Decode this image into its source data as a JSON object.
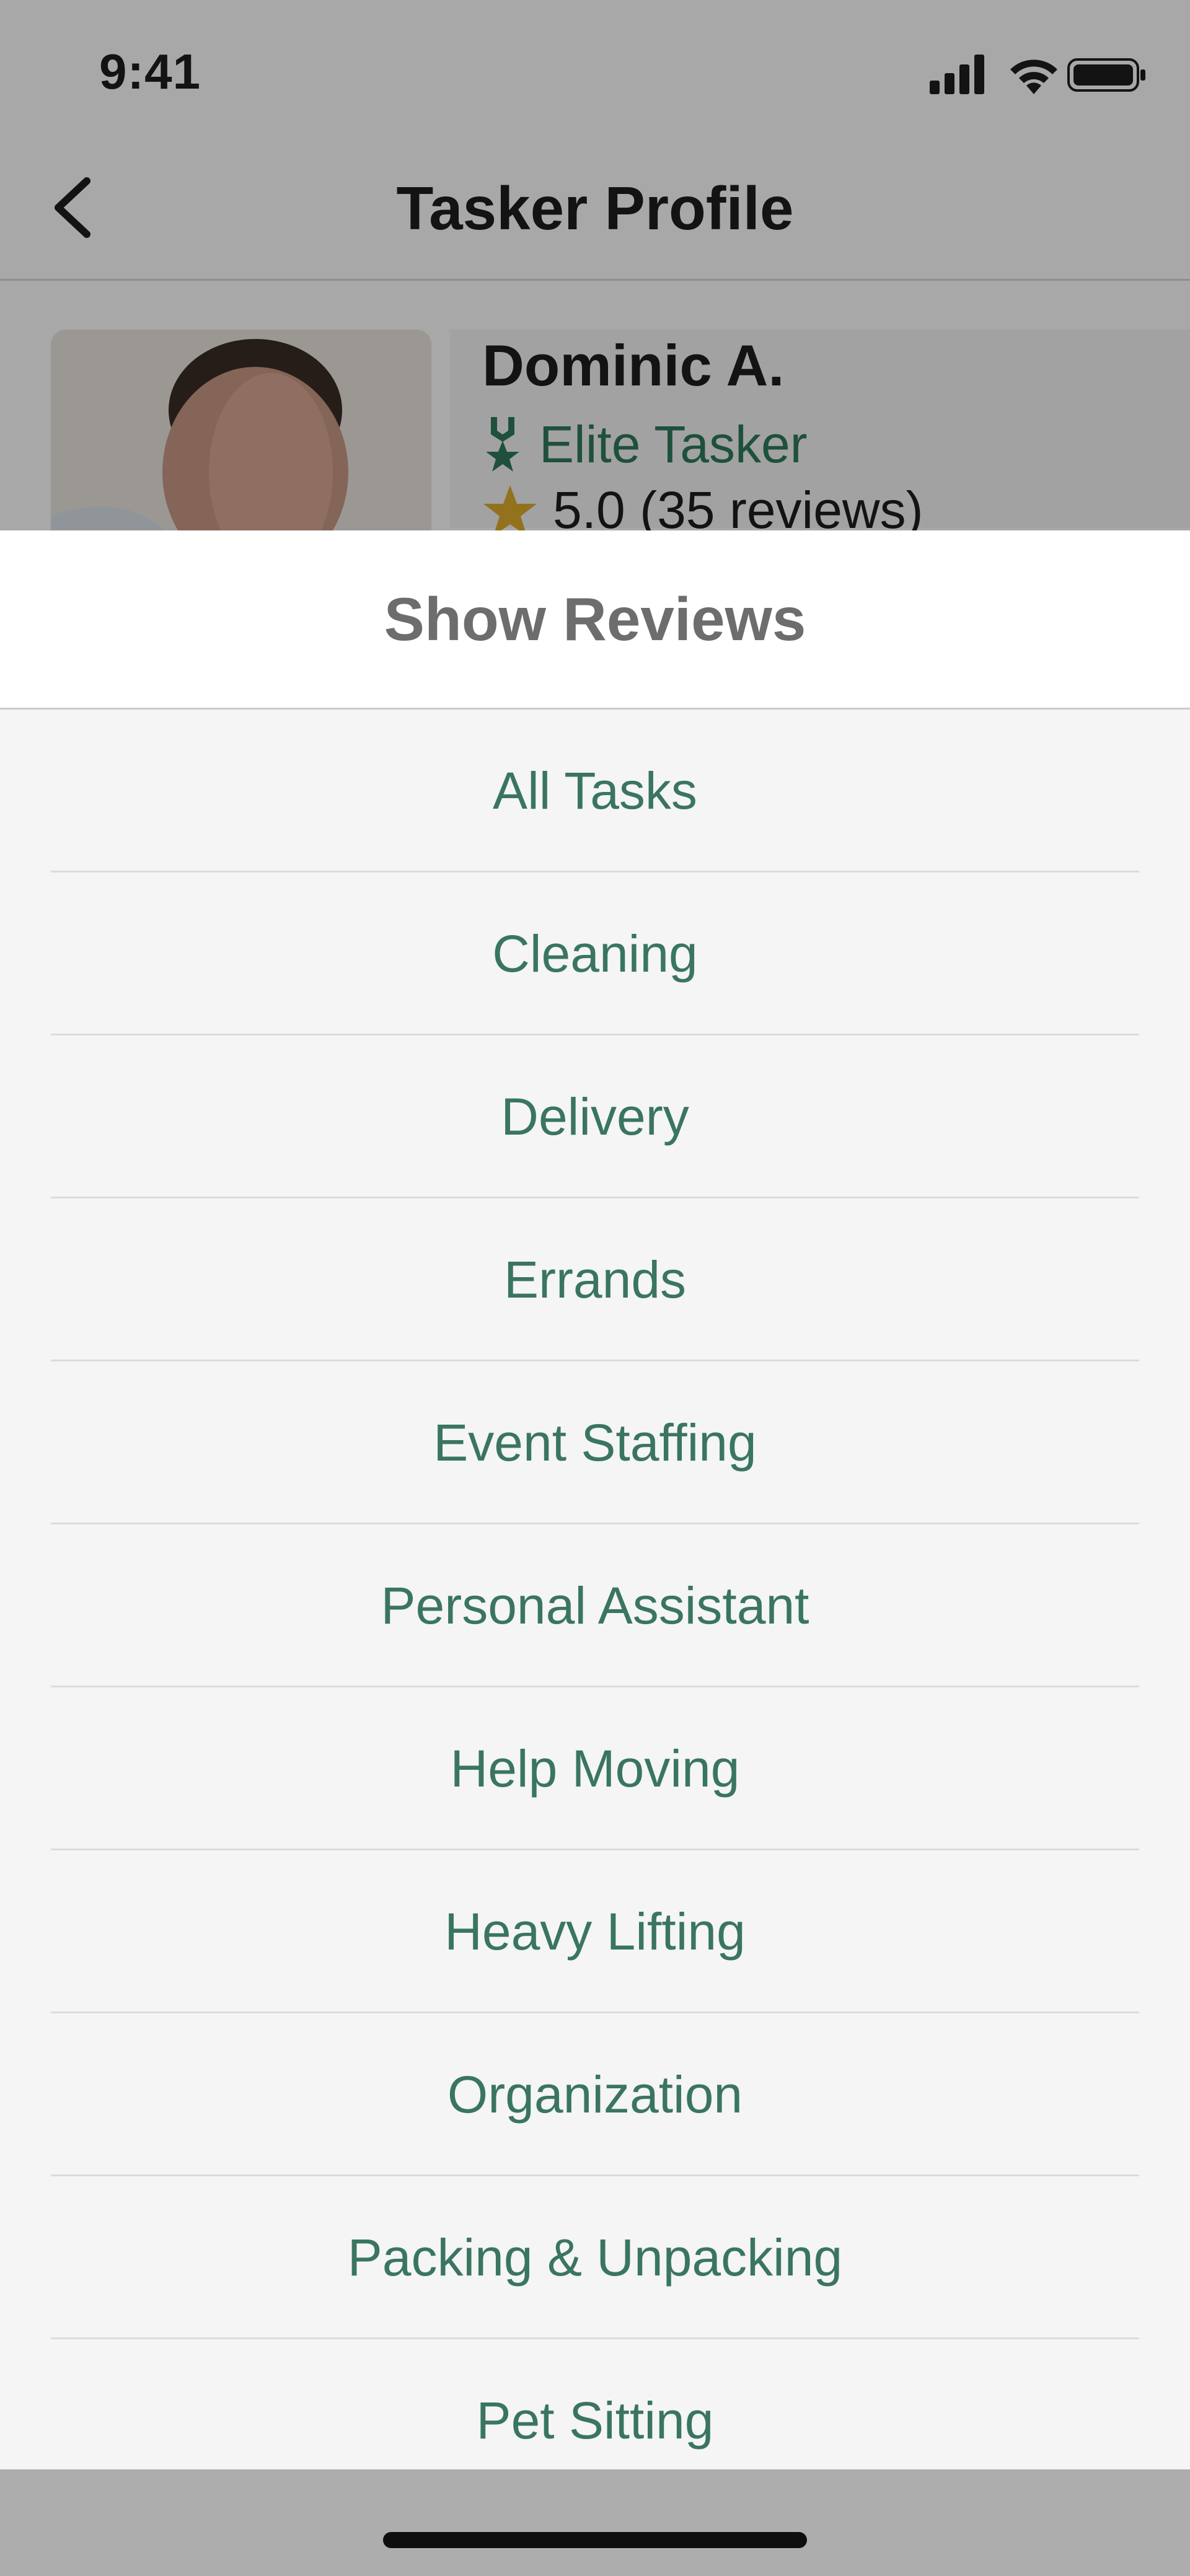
{
  "status_bar": {
    "time": "9:41"
  },
  "nav": {
    "title": "Tasker Profile"
  },
  "profile": {
    "name": "Dominic A.",
    "badge": "Elite Tasker",
    "rating": "5.0 (35 reviews)"
  },
  "sheet": {
    "title": "Show Reviews",
    "options": [
      "All Tasks",
      "Cleaning",
      "Delivery",
      "Errands",
      "Event Staffing",
      "Personal Assistant",
      "Help Moving",
      "Heavy Lifting",
      "Organization",
      "Packing & Unpacking",
      "Pet Sitting"
    ]
  },
  "colors": {
    "accent_green": "#3a7560",
    "star_gold": "#e0ad2c",
    "sheet_bg": "#f4f5f4"
  },
  "icons": [
    "signal-icon",
    "wifi-icon",
    "battery-icon",
    "back-chevron-icon",
    "elite-badge-icon",
    "star-icon"
  ]
}
